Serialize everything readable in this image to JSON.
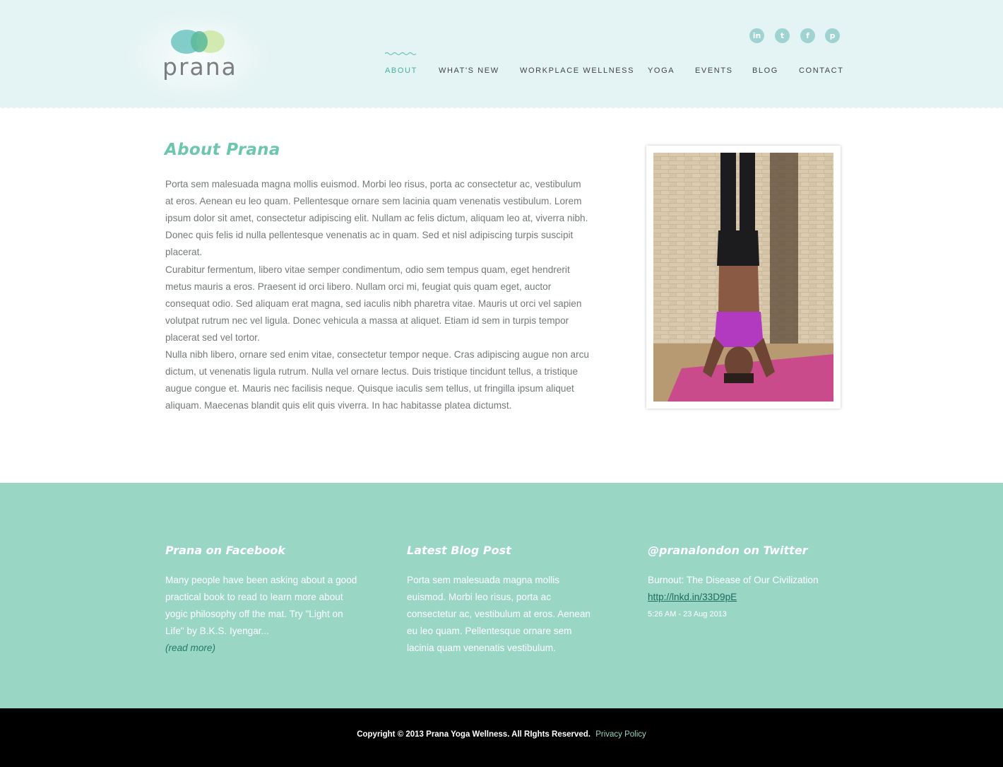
{
  "brand": {
    "logo_text": "prana",
    "colors": {
      "header_bg": "#e4f3f3",
      "accent": "#6cc6b0",
      "widgets_bg": "#9ad6c4",
      "footer_bg": "#000000"
    }
  },
  "social": [
    {
      "name": "linkedin-icon",
      "glyph": "in"
    },
    {
      "name": "twitter-icon",
      "glyph": "t"
    },
    {
      "name": "facebook-icon",
      "glyph": "f"
    },
    {
      "name": "pinterest-icon",
      "glyph": "p"
    }
  ],
  "nav": {
    "items": [
      {
        "label": "ABOUT",
        "active": true
      },
      {
        "label": "WHAT'S NEW"
      },
      {
        "label": "WORKPLACE WELLNESS"
      },
      {
        "label": "YOGA"
      },
      {
        "label": "EVENTS"
      },
      {
        "label": "BLOG"
      },
      {
        "label": "CONTACT"
      }
    ]
  },
  "main": {
    "title": "About Prana",
    "paragraphs": [
      "Porta sem malesuada magna mollis euismod. Morbi leo risus, porta ac consectetur ac, vestibulum at eros. Aenean eu leo quam. Pellentesque ornare sem lacinia quam venenatis vestibulum. Lorem ipsum dolor sit amet, consectetur adipiscing elit. Nullam ac felis dictum, aliquam leo at, viverra nibh. Donec quis felis id nulla pellentesque venenatis ac in quam. Sed et nisl adipiscing turpis suscipit placerat.",
      "Curabitur fermentum, libero vitae semper condimentum, odio sem tempus quam, eget hendrerit metus mauris a eros. Praesent id orci libero. Nullam orci mi, feugiat quis quam eget, auctor consequat odio. Sed aliquam erat magna, sed iaculis nibh pharetra vitae. Mauris ut orci vel sapien volutpat rutrum nec vel ligula. Donec vehicula a massa at aliquet. Etiam id sem in turpis tempor placerat sed vel tortor.",
      "Nulla nibh libero, ornare sed enim vitae, consectetur tempor neque. Cras adipiscing augue non arcu dictum, ut venenatis ligula rutrum. Nulla vel ornare lectus. Duis tristique tincidunt tellus, a tristique augue congue et. Mauris nec facilisis neque. Quisque iaculis sem tellus, ut fringilla ipsum aliquet aliquam. Maecenas blandit quis elit quis viverra. In hac habitasse platea dictumst."
    ]
  },
  "widgets": {
    "facebook": {
      "title": "Prana on Facebook",
      "text": "Many people have been asking about a good practical book to read to learn more about yogic philosophy off the mat. Try \"Light on Life\" by B.K.S. Iyengar...",
      "read_more": "(read more)"
    },
    "blog": {
      "title": "Latest Blog Post",
      "text": "Porta sem malesuada magna mollis euismod. Morbi leo risus, porta ac consectetur ac, vestibulum at eros. Aenean eu leo quam. Pellentesque ornare sem lacinia quam venenatis vestibulum."
    },
    "twitter": {
      "title": "@pranalondon on Twitter",
      "tweet": "Burnout: The Disease of Our Civilization",
      "link": "http://lnkd.in/33D9pE",
      "time": "5:26 AM - 23 Aug 2013"
    }
  },
  "footer": {
    "copyright": "Copyright © 2013 Prana Yoga Wellness. All RIghts Reserved.",
    "privacy": "Privacy Policy"
  }
}
